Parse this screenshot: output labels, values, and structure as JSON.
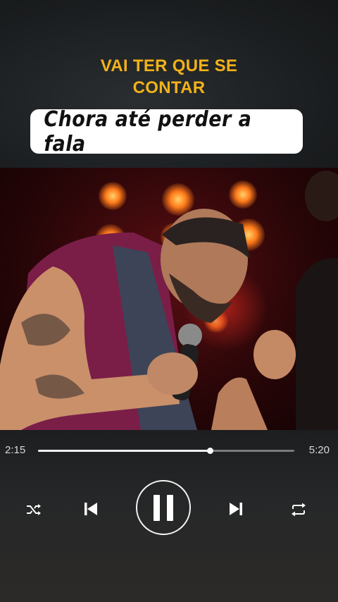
{
  "captions": {
    "line1": "VAI TER QUE SE",
    "line2": "CONTAR",
    "lyric": "Chora até perder a fala"
  },
  "player": {
    "elapsed": "2:15",
    "duration": "5:20",
    "progress_fraction": 0.67,
    "state": "playing"
  },
  "controls": {
    "shuffle_icon": "shuffle-icon",
    "previous_icon": "skip-previous-icon",
    "pause_icon": "pause-icon",
    "next_icon": "skip-next-icon",
    "repeat_icon": "repeat-icon"
  },
  "colors": {
    "caption_yellow": "#f2b21a",
    "stage_red": "#5a0e12"
  }
}
